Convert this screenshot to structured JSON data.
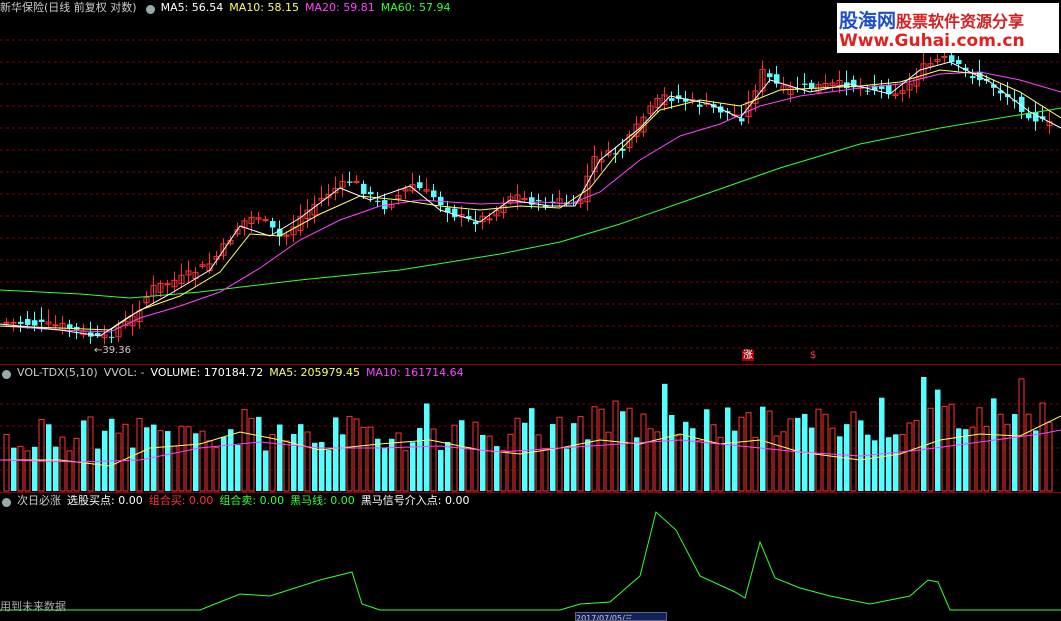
{
  "price_header": {
    "title": "新华保险(日线 前复权 对数)",
    "ma5": "MA5: 56.54",
    "ma10": "MA10: 58.15",
    "ma20": "MA20: 59.81",
    "ma60": "MA60: 57.94",
    "colors": {
      "ma5": "#ffffff",
      "ma10": "#ffff66",
      "ma20": "#ff44ff",
      "ma60": "#33ff33"
    }
  },
  "low_label": "←39.36",
  "markers": {
    "zhang": "涨",
    "dollar": "$"
  },
  "volume_header": {
    "name": "VOL-TDX(5,10)",
    "vvol": "VVOL: -",
    "volume": "VOLUME: 170184.72",
    "ma5": "MA5: 205979.45",
    "ma10": "MA10: 161714.64"
  },
  "indicator_header": {
    "name": "次日必涨",
    "xuangu": "选股买点: 0.00",
    "zuhe_buy": "组合买: 0.00",
    "zuhe_sell": "组合卖: 0.00",
    "heima": "黑马线: 0.00",
    "heima_signal": "黑马信号介入点: 0.00"
  },
  "bottom_note": "用到未来数据",
  "date_box": "2017/07/05/三",
  "watermark": {
    "brand": "股海网",
    "slogan": "股票软件资源分享",
    "url": "Www.Guhai.com.cn"
  },
  "colors": {
    "up": "#ff3232",
    "down": "#54ffff",
    "grid": "#7a0000",
    "indicator": "#33ff33"
  }
}
